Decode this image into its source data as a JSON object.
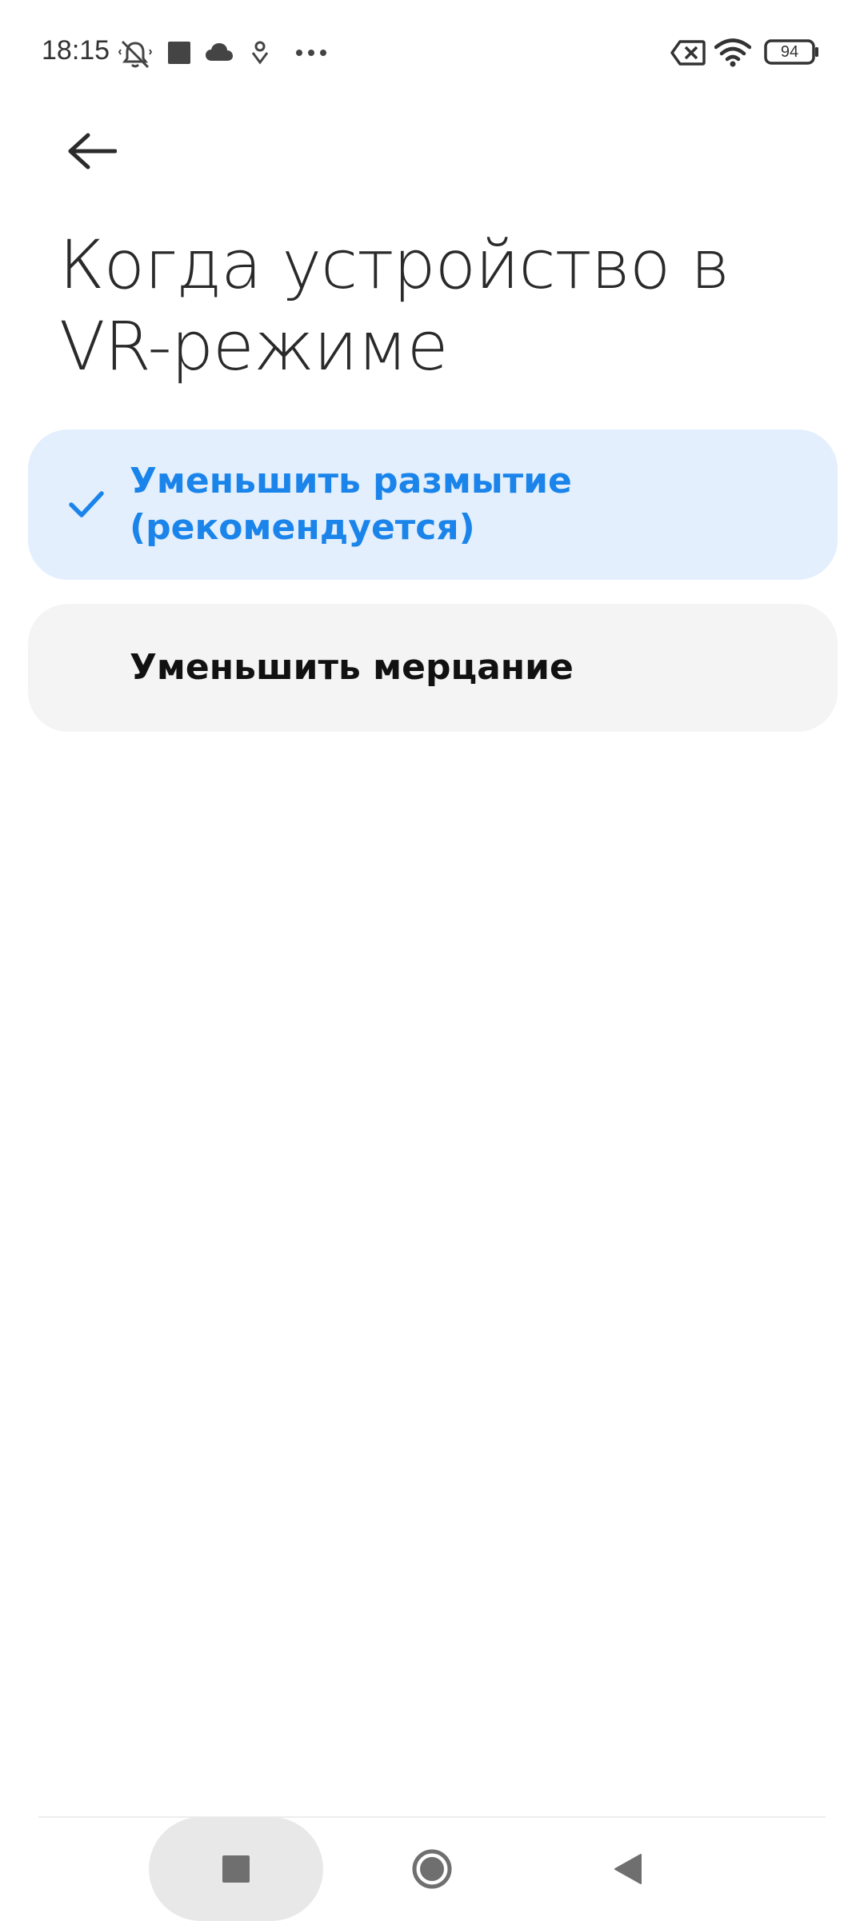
{
  "status_bar": {
    "time": "18:15",
    "battery_level": "94",
    "icons": [
      "mute-vibrate-icon",
      "square-notification-icon",
      "cloud-icon",
      "location-pin-icon",
      "more-dots-icon",
      "sim-off-icon",
      "wifi-icon",
      "battery-icon"
    ]
  },
  "header": {
    "back_icon": "arrow-left-icon",
    "title": "Когда устройство в VR-режиме"
  },
  "options": [
    {
      "label": "Уменьшить размытие (рекомендуется)",
      "selected": true,
      "icon": "check-icon"
    },
    {
      "label": "Уменьшить мерцание",
      "selected": false
    }
  ],
  "colors": {
    "accent": "#1a84ea",
    "selected_bg": "#e3effd",
    "card_bg": "#f4f4f4"
  },
  "nav_bar": {
    "buttons": [
      "recents-square-icon",
      "home-circle-icon",
      "back-triangle-icon"
    ]
  }
}
